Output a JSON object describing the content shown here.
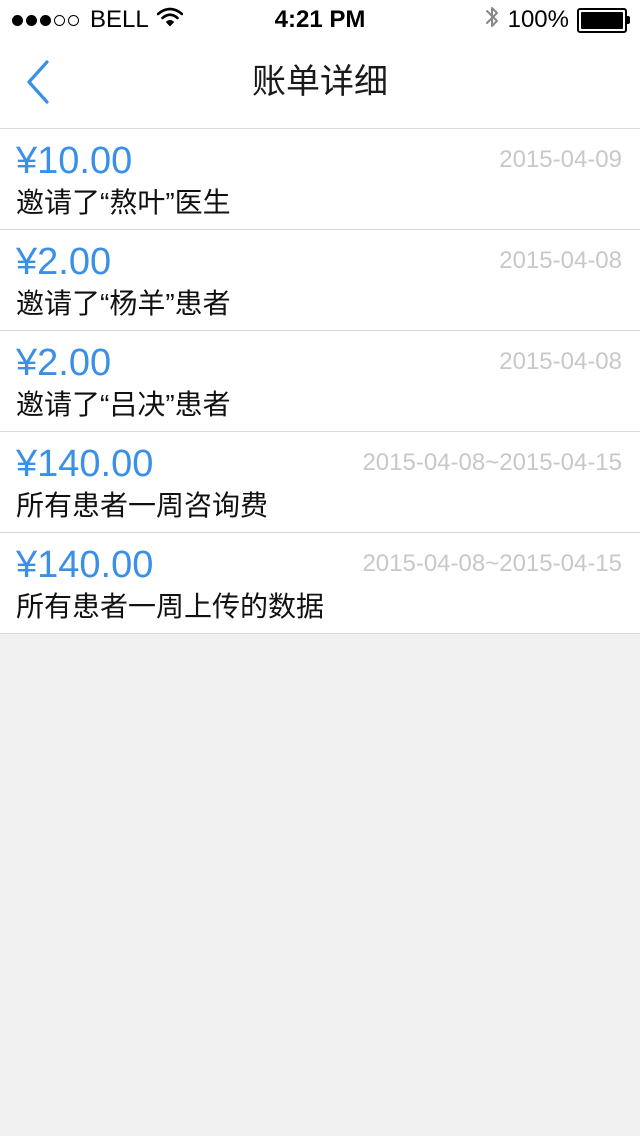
{
  "status_bar": {
    "carrier": "BELL",
    "time": "4:21 PM",
    "battery": "100%",
    "battery_level": 1.0,
    "icons": [
      "signal-dots-icon",
      "wifi-icon",
      "bluetooth-icon",
      "battery-icon"
    ]
  },
  "nav": {
    "title": "账单详细",
    "back_icon": "chevron-left-icon"
  },
  "colors": {
    "accent": "#3a8fe6",
    "date": "#c8c8c8",
    "separator": "#d9d9d9",
    "background": "#f0f0f0"
  },
  "bills": [
    {
      "amount": "¥10.00",
      "date": "2015-04-09",
      "desc": "邀请了“熬叶”医生"
    },
    {
      "amount": "¥2.00",
      "date": "2015-04-08",
      "desc": "邀请了“杨羊”患者"
    },
    {
      "amount": "¥2.00",
      "date": "2015-04-08",
      "desc": "邀请了“吕决”患者"
    },
    {
      "amount": "¥140.00",
      "date": "2015-04-08~2015-04-15",
      "desc": "所有患者一周咨询费"
    },
    {
      "amount": "¥140.00",
      "date": "2015-04-08~2015-04-15",
      "desc": "所有患者一周上传的数据"
    }
  ]
}
